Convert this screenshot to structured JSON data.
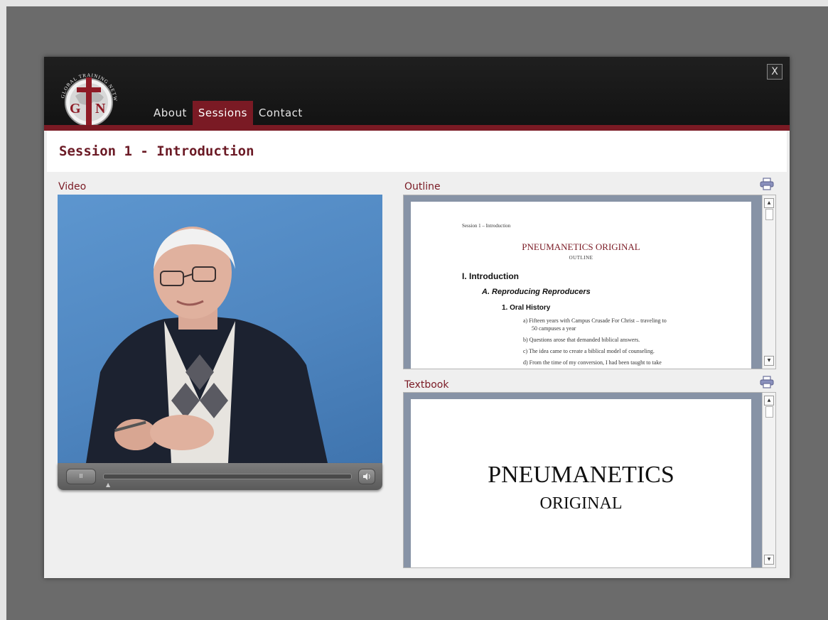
{
  "header": {
    "logo_text": "GLOBAL TRAINING NETWORK",
    "logo_initials": "GTN",
    "close_label": "X",
    "nav": [
      {
        "label": "About",
        "active": false
      },
      {
        "label": "Sessions",
        "active": true
      },
      {
        "label": "Contact",
        "active": false
      }
    ]
  },
  "page_title": "Session 1 - Introduction",
  "video": {
    "label": "Video",
    "play_label": "II",
    "progress": 0.0
  },
  "outline": {
    "label": "Outline",
    "doc": {
      "header_line": "Session 1 – Introduction",
      "title": "PNEUMANETICS ORIGINAL",
      "subtitle": "OUTLINE",
      "heading_1": "I. Introduction",
      "heading_2": "A. Reproducing Reproducers",
      "heading_3": "1. Oral History",
      "items": [
        "a)   Fifteen years with Campus Crusade For Christ – traveling to",
        "50 campuses a year",
        "b)   Questions arose that demanded biblical answers.",
        "c)   The idea came to create a biblical model of counseling.",
        "d)   From the time of my conversion, I had been taught to take"
      ]
    }
  },
  "textbook": {
    "label": "Textbook",
    "doc": {
      "title": "PNEUMANETICS",
      "subtitle": "ORIGINAL"
    }
  },
  "colors": {
    "accent": "#7a1a24",
    "header_bg": "#151515",
    "overlay": "#6b6b6b",
    "video_bg": "#4f86c0"
  }
}
